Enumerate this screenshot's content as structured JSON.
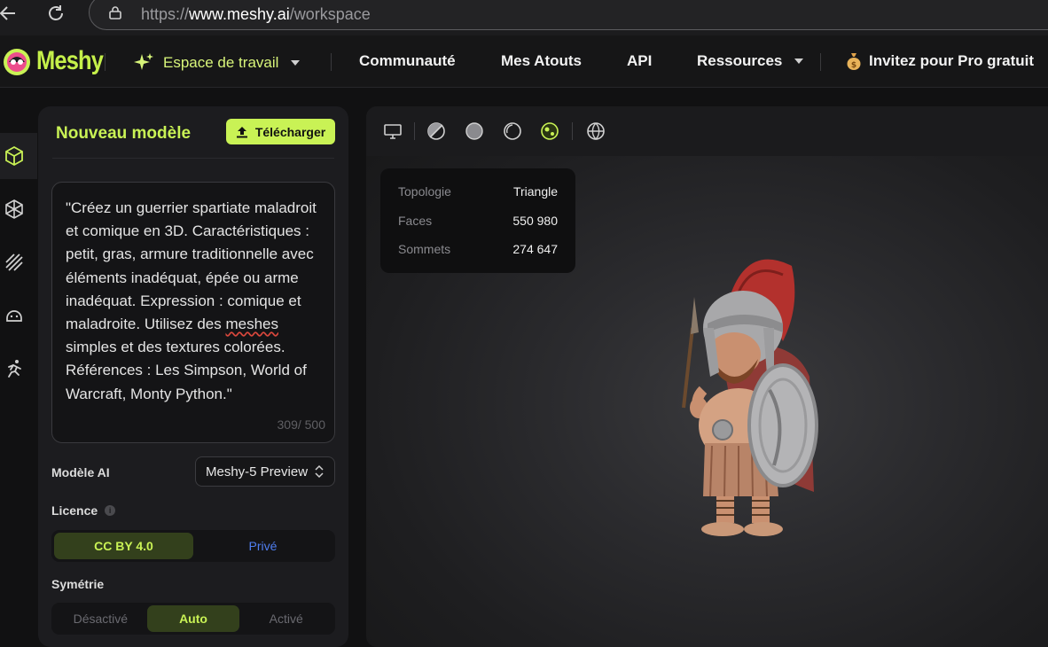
{
  "browser": {
    "back_icon": "arrow-left-icon",
    "reload_icon": "reload-icon",
    "lock_icon": "lock-icon",
    "url_prefix": "https://",
    "url_host": "www.meshy.ai",
    "url_path": "/workspace"
  },
  "nav": {
    "logo_text": "Meshy",
    "items": [
      {
        "label": "Espace de travail",
        "icon": "sparkle-icon",
        "dropdown": true,
        "active": true
      },
      {
        "label": "Communauté"
      },
      {
        "label": "Mes Atouts"
      },
      {
        "label": "API"
      },
      {
        "label": "Ressources",
        "dropdown": true
      },
      {
        "label": "Invitez pour Pro gratuit",
        "icon": "money-bag-icon"
      }
    ]
  },
  "rail": {
    "items": [
      "cube-icon",
      "texture-icon",
      "stripes-icon",
      "helmet-icon",
      "running-icon"
    ]
  },
  "panel": {
    "title": "Nouveau modèle",
    "upload_label": "Télécharger",
    "prompt_before": "\"Créez un guerrier spartiate maladroit et comique en 3D. Caractéristiques : petit, gras, armure traditionnelle avec éléments inadéquat, épée ou arme inadéquat. Expression : comique et maladroite. Utilisez des ",
    "prompt_misspelled": "meshes",
    "prompt_after": " simples et des textures colorées. Références : Les Simpson, World of Warcraft, Monty Python.\"",
    "char_count": "309/ 500",
    "model_label": "Modèle AI",
    "model_value": "Meshy-5 Preview",
    "license_label": "Licence",
    "license_options": [
      "CC BY 4.0",
      "Privé"
    ],
    "license_selected": 0,
    "symmetry_label": "Symétrie",
    "symmetry_options": [
      "Désactivé",
      "Auto",
      "Activé"
    ],
    "symmetry_selected": 1
  },
  "viewport": {
    "toolbar_icons": [
      "monitor-icon",
      "half-sphere-icon",
      "solid-sphere-icon",
      "outline-sphere-icon",
      "textured-sphere-icon",
      "globe-icon"
    ],
    "active_tool": "textured-sphere-icon",
    "stats": [
      {
        "label": "Topologie",
        "value": "Triangle"
      },
      {
        "label": "Faces",
        "value": "550 980"
      },
      {
        "label": "Sommets",
        "value": "274 647"
      }
    ]
  },
  "colors": {
    "accent": "#c9f255",
    "accent_dark": "#33401c",
    "private_blue": "#4f7ef0",
    "panel_bg": "#1c1c1f"
  }
}
